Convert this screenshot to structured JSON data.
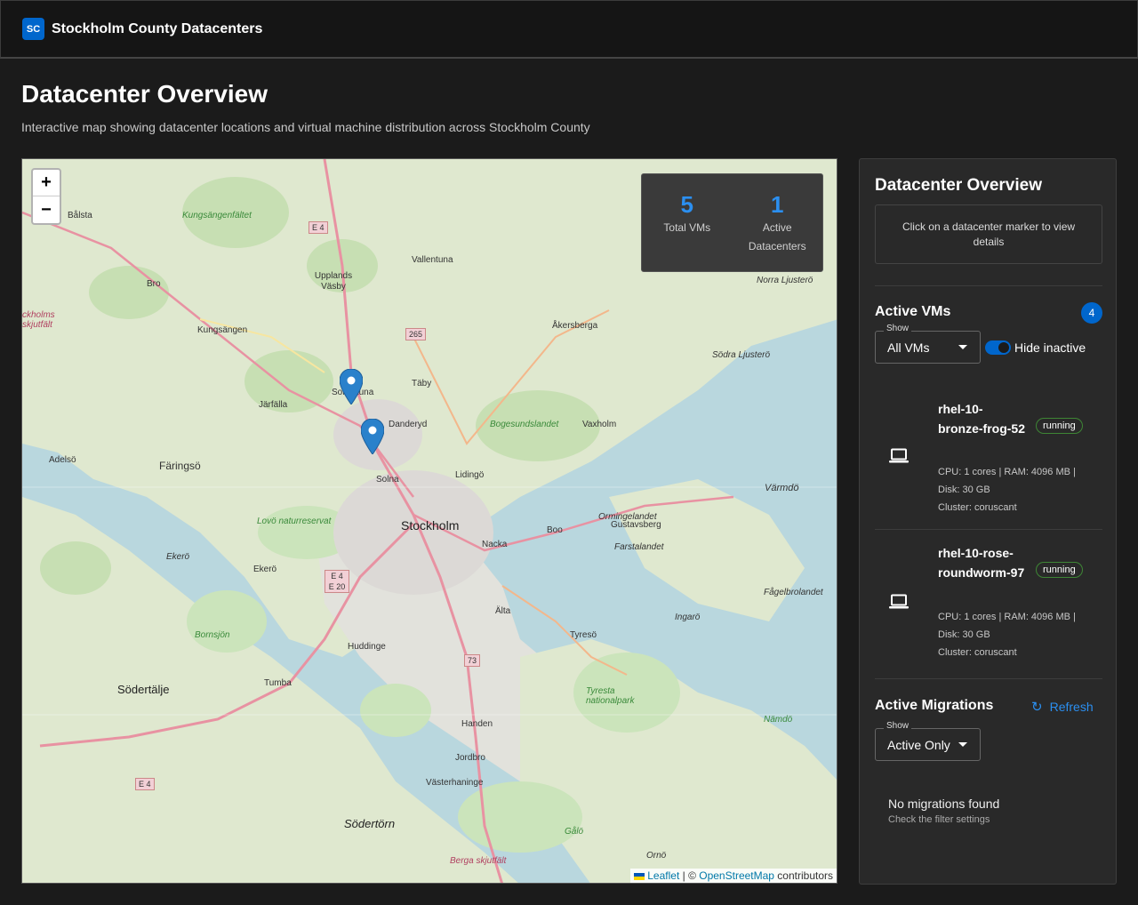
{
  "header": {
    "logo_text": "SC",
    "title": "Stockholm County Datacenters"
  },
  "page": {
    "title": "Datacenter Overview",
    "subtitle": "Interactive map showing datacenter locations and virtual machine distribution across Stockholm County"
  },
  "map": {
    "zoom_in": "+",
    "zoom_out": "−",
    "stats": {
      "total_vms": "5",
      "total_vms_label": "Total VMs",
      "active_dc": "1",
      "active_dc_label": "Active Datacenters"
    },
    "labels": {
      "balsta": "Bålsta",
      "kungsangen_faltet": "Kungsängenfältet",
      "vallentuna": "Vallentuna",
      "upplands_vasby": "Upplands Väsby",
      "bro": "Bro",
      "kungsangen": "Kungsängen",
      "akersberga": "Åkersberga",
      "norra_ljustero": "Norra Ljusterö",
      "sodra_ljustero": "Södra Ljusterö",
      "jarfalla": "Järfälla",
      "sollentuna": "Sollentuna",
      "taby": "Täby",
      "danderyd": "Danderyd",
      "bogesundslandet": "Bogesundslandet",
      "vaxholm": "Vaxholm",
      "adelso": "Adelsö",
      "faringso": "Färingsö",
      "solna": "Solna",
      "lidingo": "Lidingö",
      "varmdo": "Värmdö",
      "lovo": "Lovö naturreservat",
      "stockholm": "Stockholm",
      "ormingelandet": "Ormingelandet",
      "gustavsberg": "Gustavsberg",
      "boo": "Boo",
      "nacka": "Nacka",
      "farstalandet": "Farstalandet",
      "ekero_island": "Ekerö",
      "ekero": "Ekerö",
      "fagelbrolandet": "Fågelbrolandet",
      "alta": "Älta",
      "ingaro": "Ingarö",
      "bornsjon": "Bornsjön",
      "huddinge": "Huddinge",
      "tyreso": "Tyresö",
      "sodertalje": "Södertälje",
      "tumba": "Tumba",
      "tyresta": "Tyresta nationalpark",
      "handen": "Handen",
      "jordbro": "Jordbro",
      "vasterhaninge": "Västerhaninge",
      "nampa": "Nämdö",
      "sodertorn": "Södertörn",
      "galo": "Gålö",
      "orno": "Ornö",
      "berga": "Berga skjutfält",
      "ckholms": "ckholms skjutfält"
    },
    "shields": {
      "e4_north": "E 4",
      "r265": "265",
      "e4_e20": "E 4 E 20",
      "r73": "73",
      "e4_south": "E 4"
    },
    "attribution": {
      "leaflet": "Leaflet",
      "sep": " | © ",
      "osm": "OpenStreetMap",
      "contrib": " contributors"
    }
  },
  "panel": {
    "title": "Datacenter Overview",
    "info": "Click on a datacenter marker to view details",
    "vms_title": "Active VMs",
    "vms_count": "4",
    "show_label": "Show",
    "vm_filter": "All VMs",
    "hide_inactive": "Hide inactive",
    "vms": [
      {
        "name": "rhel-10-bronze-frog-52",
        "status": "running",
        "specs": "CPU: 1 cores | RAM: 4096 MB | Disk: 30 GB",
        "cluster": "Cluster: coruscant"
      },
      {
        "name": "rhel-10-rose-roundworm-97",
        "status": "running",
        "specs": "CPU: 1 cores | RAM: 4096 MB | Disk: 30 GB",
        "cluster": "Cluster: coruscant"
      }
    ],
    "migrations_title": "Active Migrations",
    "refresh": "Refresh",
    "migration_filter": "Active Only",
    "empty_title": "No migrations found",
    "empty_sub": "Check the filter settings"
  },
  "colors": {
    "accent": "#0066cc",
    "accent_text": "#2b8ff0",
    "running_border": "#3e8635",
    "marker": "#2a81cb"
  },
  "icons": {
    "laptop": "laptop-icon",
    "refresh": "refresh-icon",
    "marker": "map-marker-icon"
  }
}
